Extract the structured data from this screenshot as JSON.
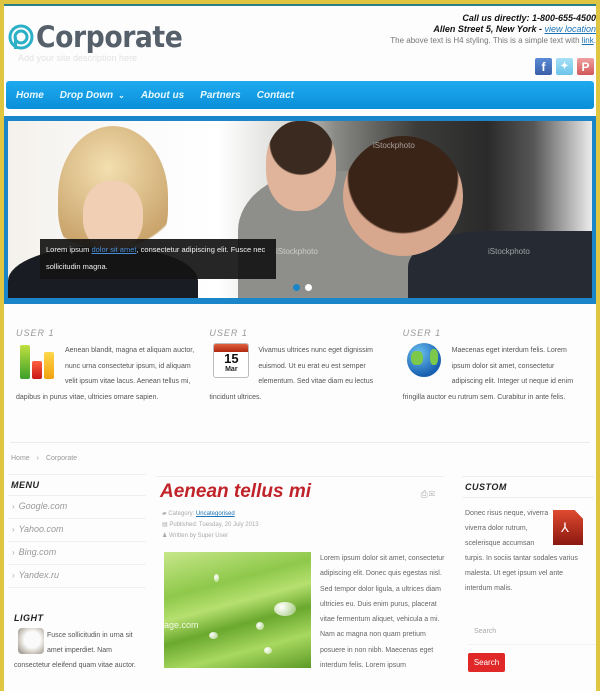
{
  "header": {
    "logo_text": "Corporate",
    "tagline": "Add your site description here",
    "contact_call": "Call us directly: 1-800-655-4500",
    "contact_address": "Allen Street 5, New York -",
    "contact_address_link": "view location",
    "contact_note": "The above text is H4 styling. This is a simple text with",
    "contact_note_link": "link",
    "social": [
      {
        "name": "facebook",
        "glyph": "f"
      },
      {
        "name": "twitter",
        "glyph": "🐦"
      },
      {
        "name": "pinterest",
        "glyph": "P"
      }
    ]
  },
  "nav": {
    "items": [
      {
        "label": "Home"
      },
      {
        "label": "Drop Down",
        "chevron": "⌄"
      },
      {
        "label": "About us"
      },
      {
        "label": "Partners"
      },
      {
        "label": "Contact"
      }
    ]
  },
  "slider": {
    "caption_before": "Lorem ipsum",
    "caption_link": "dolor sit amet",
    "caption_after": ", consectetur adipiscing elit. Fusce nec sollicitudin magna.",
    "watermark": "iStockphoto",
    "slides_total": 2,
    "active_slide": 1
  },
  "features": [
    {
      "title": "USER 1",
      "icon": "bar-chart-icon",
      "text": "Aenean blandit, magna et aliquam auctor, nunc urna consectetur ipsum, id aliquam velit ipsum vitae lacus. Aenean tellus mi, dapibus in purus vitae, ultricies ornare sapien."
    },
    {
      "title": "USER 1",
      "icon": "calendar-icon",
      "calendar_day": "15",
      "calendar_month": "Mar",
      "text": "Vivamus ultrices nunc eget dignissim euismod. Ut eu erat eu est semper elementum. Sed vitae diam eu lectus tincidunt ultrices."
    },
    {
      "title": "USER 1",
      "icon": "globe-icon",
      "text": "Maecenas eget interdum felis. Lorem ipsum dolor sit amet, consectetur adipiscing elit. Integer ut neque id enim fringilla auctor eu rutrum sem. Curabitur in ante felis."
    }
  ],
  "breadcrumb": {
    "home": "Home",
    "separator": "›",
    "current": "Corporate"
  },
  "left_sidebar": {
    "menu_title": "MENU",
    "menu_items": [
      {
        "label": "Google.com"
      },
      {
        "label": "Yahoo.com"
      },
      {
        "label": "Bing.com"
      },
      {
        "label": "Yandex.ru"
      }
    ],
    "light_title": "LIGHT",
    "light_text": "Fusce sollicitudin in urna sit amet imperdiet. Nam consectetur eleifend quam vitae auctor."
  },
  "article": {
    "title": "Aenean tellus mi",
    "category_label": "Category:",
    "category_link": "Uncategorised",
    "published": "Published: Tuesday, 20 July 2013",
    "author": "Written by Super User",
    "image_watermark": "age.com",
    "body": "Lorem ipsum dolor sit amet, consectetur adipiscing elit. Donec quis egestas nisl. Sed tempor dolor ligula, a ultrices diam ultricies eu. Duis enim purus, placerat vitae fermentum aliquet, vehicula a mi. Nam ac magna non quam pretium posuere in non nibh. Maecenas eget interdum felis. Lorem ipsum",
    "tools": "print / email"
  },
  "right_sidebar": {
    "custom_title": "CUSTOM",
    "custom_text": "Donec risus neque, viverra viverra dolor rutrum, scelerisque accumsan turpis. In sociis tantar sodales varius malesta. Ut eget ipsum vel ante interdum malis.",
    "search_placeholder": "Search",
    "search_button": "Search"
  },
  "colors": {
    "frame": "#e0c540",
    "nav": "#1eaaf0",
    "slider_border": "#1a85c8",
    "title_red": "#c0242a",
    "button_red": "#e02828"
  }
}
